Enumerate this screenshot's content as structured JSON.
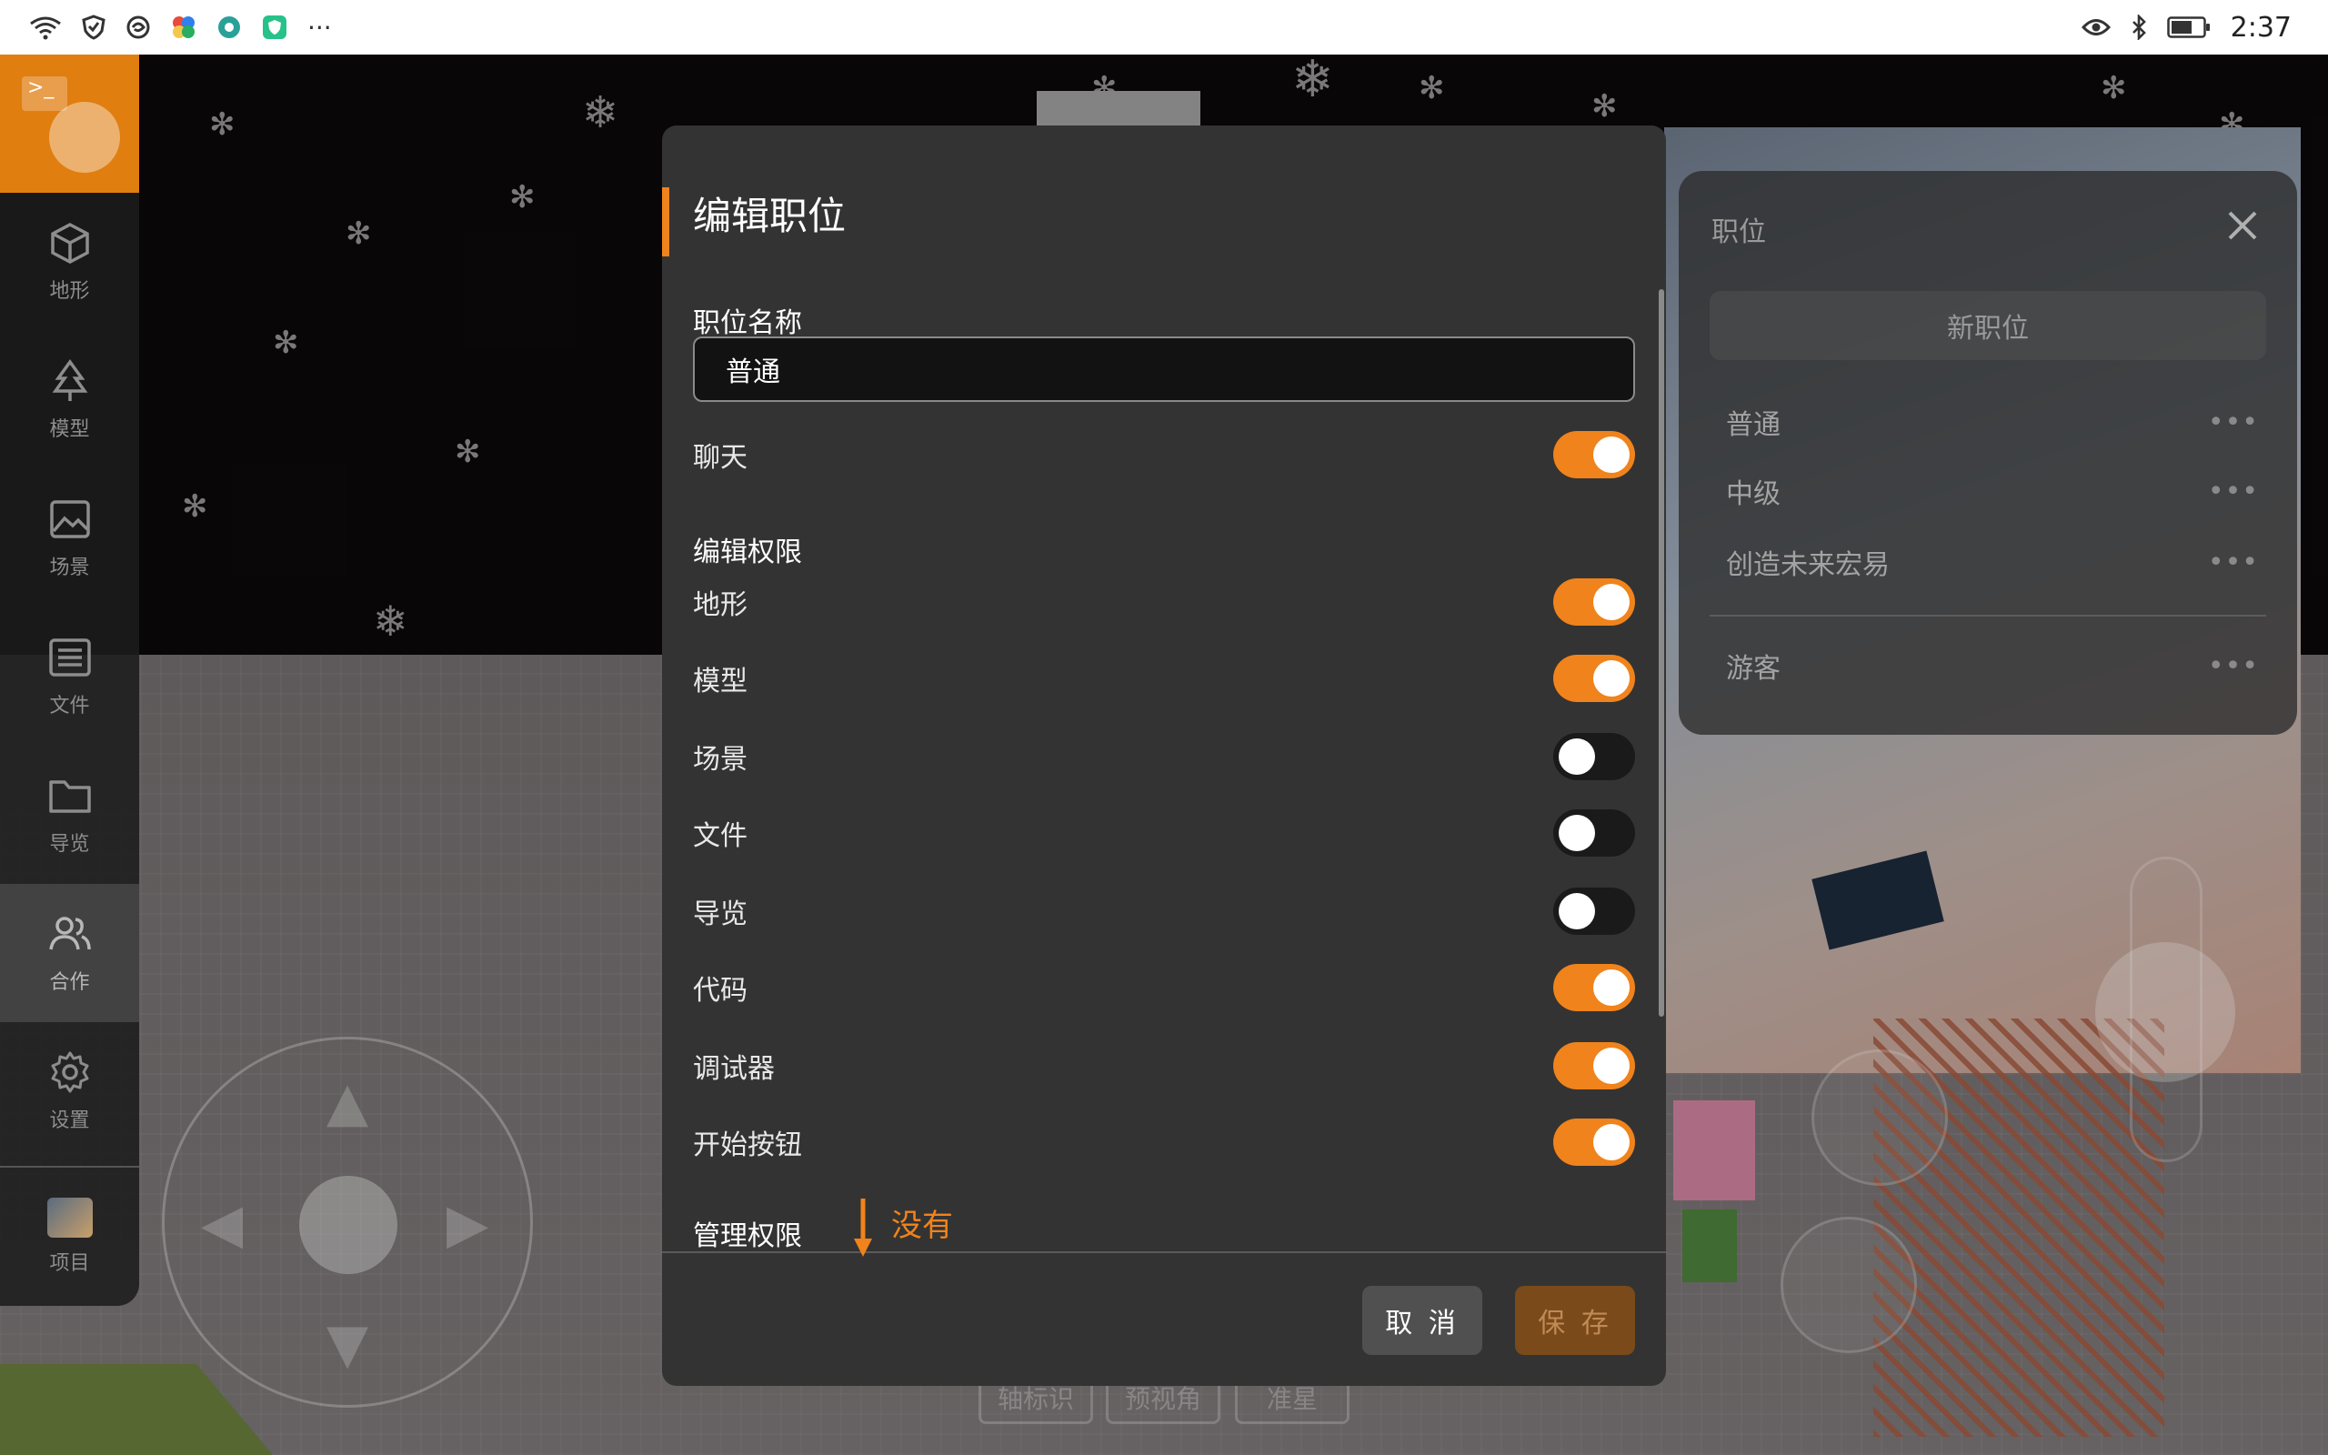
{
  "status_bar": {
    "time": "2:37",
    "left_icons": [
      "wifi-signal-icon",
      "shield-icon",
      "swirl-app-icon",
      "colorful-app-icon",
      "globe-app-icon",
      "green-shield-app-icon"
    ],
    "more_indicator": "···",
    "right_icons": [
      "eye-icon",
      "bluetooth-icon",
      "battery-icon"
    ]
  },
  "sidebar": {
    "items": [
      {
        "label": "地形",
        "icon": "cube-icon"
      },
      {
        "label": "模型",
        "icon": "tree-icon"
      },
      {
        "label": "场景",
        "icon": "image-icon"
      },
      {
        "label": "文件",
        "icon": "list-icon"
      },
      {
        "label": "导览",
        "icon": "folder-icon"
      },
      {
        "label": "合作",
        "icon": "users-icon",
        "active": true
      },
      {
        "label": "设置",
        "icon": "gear-icon"
      },
      {
        "label": "项目",
        "icon": "project-thumbnail"
      }
    ]
  },
  "roles_panel": {
    "title": "职位",
    "new_button": "新职位",
    "roles": [
      "普通",
      "中级",
      "创造未来宏易",
      "游客"
    ],
    "more": "•••"
  },
  "dialog": {
    "title": "编辑职位",
    "name_label": "职位名称",
    "name_value": "普通",
    "chat_label": "聊天",
    "chat_on": true,
    "edit_section": "编辑权限",
    "permissions": [
      {
        "label": "地形",
        "on": true
      },
      {
        "label": "模型",
        "on": true
      },
      {
        "label": "场景",
        "on": false
      },
      {
        "label": "文件",
        "on": false
      },
      {
        "label": "导览",
        "on": false
      },
      {
        "label": "代码",
        "on": true
      },
      {
        "label": "调试器",
        "on": true
      },
      {
        "label": "开始按钮",
        "on": true
      }
    ],
    "admin_section": "管理权限",
    "cancel": "取 消",
    "save": "保 存"
  },
  "annotation": {
    "text": "没有",
    "color": "#f0831b"
  },
  "hud": {
    "hint_buttons": [
      "轴标识",
      "预视角",
      "准星"
    ]
  },
  "colors": {
    "accent": "#f0831b",
    "dialog_bg": "#333333",
    "toggle_off": "#1a1a1a"
  }
}
